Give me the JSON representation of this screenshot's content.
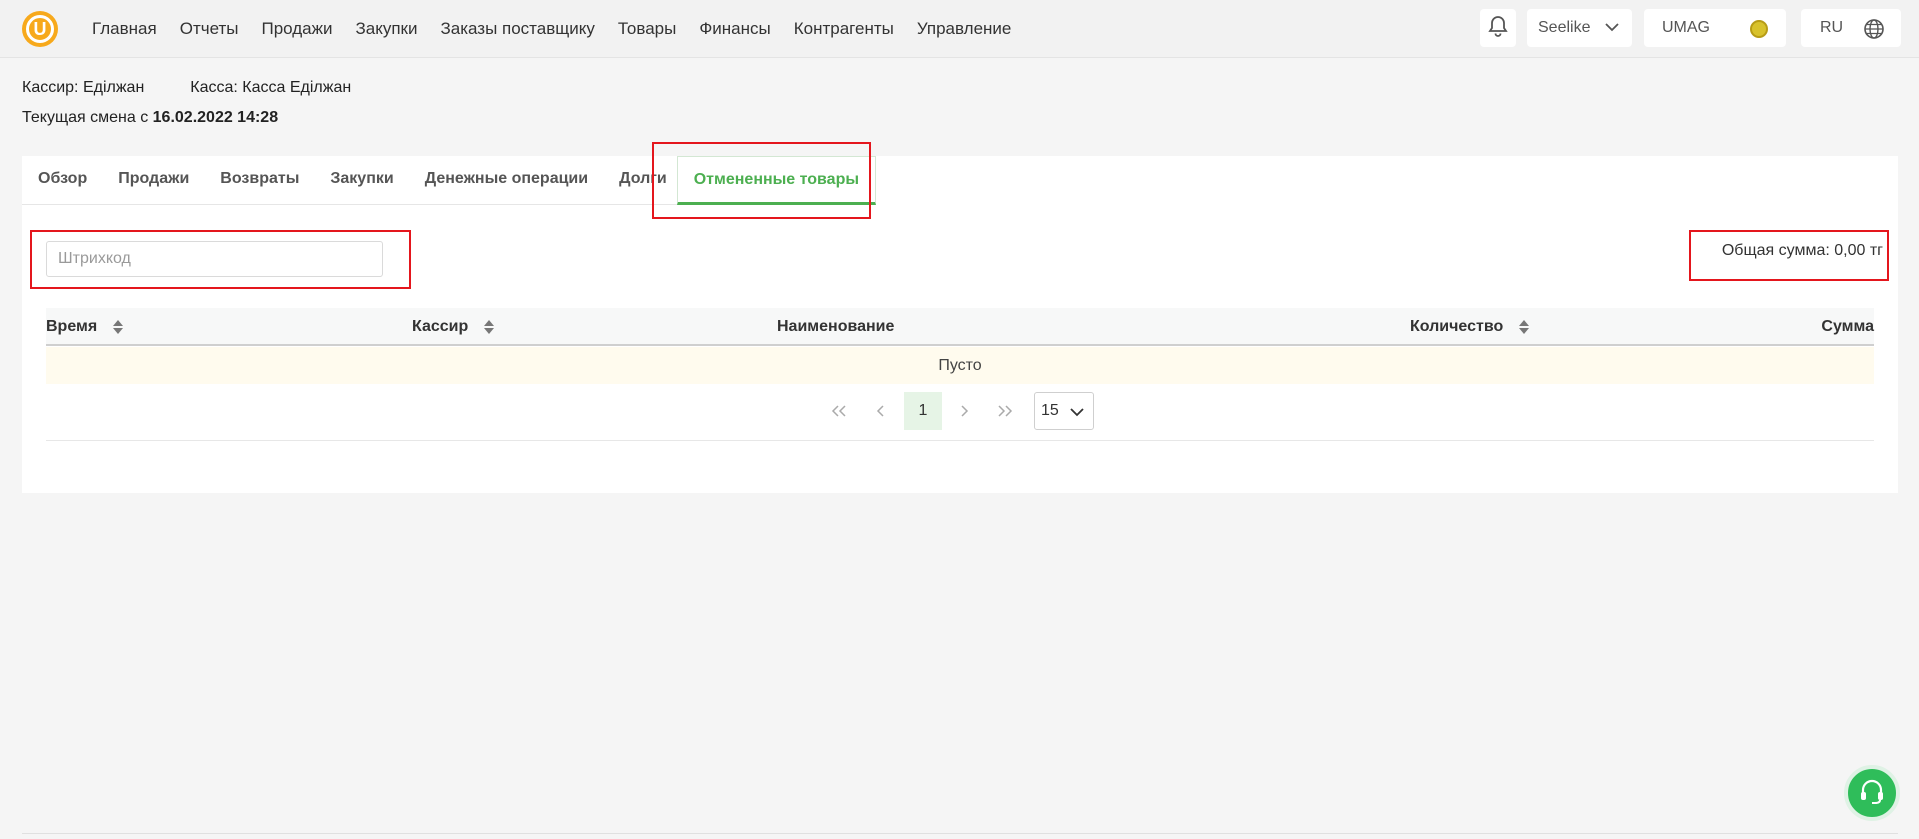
{
  "nav": {
    "items": [
      "Главная",
      "Отчеты",
      "Продажи",
      "Закупки",
      "Заказы поставщику",
      "Товары",
      "Финансы",
      "Контрагенты",
      "Управление"
    ],
    "logo_letter": "U"
  },
  "header": {
    "store_name": "Seelike",
    "brand": "UMAG",
    "language": "RU"
  },
  "session": {
    "cashier": "Кассир: Еділжан",
    "register": "Касса: Касса Еділжан",
    "shift_prefix": "Текущая смена с",
    "shift_start": "16.02.2022 14:28"
  },
  "tabs": [
    "Обзор",
    "Продажи",
    "Возвраты",
    "Закупки",
    "Денежные операции",
    "Долги",
    "Отмененные товары"
  ],
  "active_tab": "Отмененные товары",
  "filters": {
    "barcode_placeholder": "Штрихкод",
    "barcode_value": ""
  },
  "total": "Общая сумма: 0,00 тг",
  "table": {
    "columns": [
      "Время",
      "Кассир",
      "Наименование",
      "Количество",
      "Сумма"
    ],
    "rows": [],
    "empty_text": "Пусто"
  },
  "pagination": {
    "current_page": "1",
    "page_size": "15"
  },
  "colors": {
    "accent": "#4caf50",
    "highlight": "#e4161d",
    "logo": "#f7a91c",
    "support": "#2fbd5a"
  }
}
